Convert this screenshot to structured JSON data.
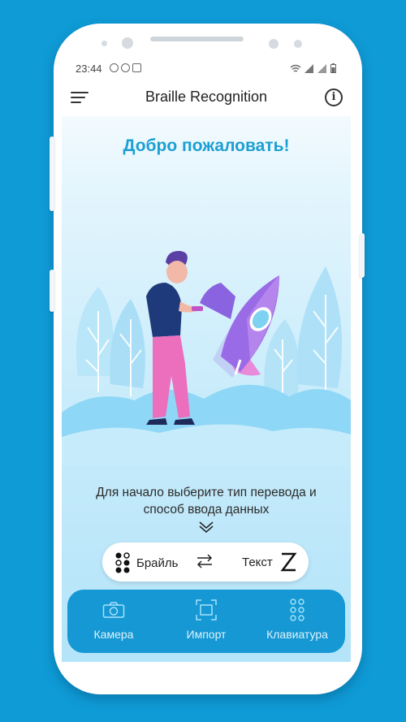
{
  "status_bar": {
    "time": "23:44"
  },
  "app_bar": {
    "title": "Braille Recognition"
  },
  "main": {
    "welcome": "Добро пожаловать!",
    "hint_line1": "Для начало выберите тип перевода и",
    "hint_line2": "способ ввода данных"
  },
  "translate_pill": {
    "source_label": "Брайль",
    "target_label": "Текст"
  },
  "bottom_nav": {
    "items": [
      {
        "label": "Камера",
        "icon": "camera-icon"
      },
      {
        "label": "Импорт",
        "icon": "import-frame-icon"
      },
      {
        "label": "Клавиатура",
        "icon": "braille-keyboard-icon"
      }
    ]
  },
  "colors": {
    "background": "#0f9bd6",
    "accent": "#1d9fd3",
    "nav_bar": "#1598d3",
    "rocket": "#8a63e0"
  }
}
